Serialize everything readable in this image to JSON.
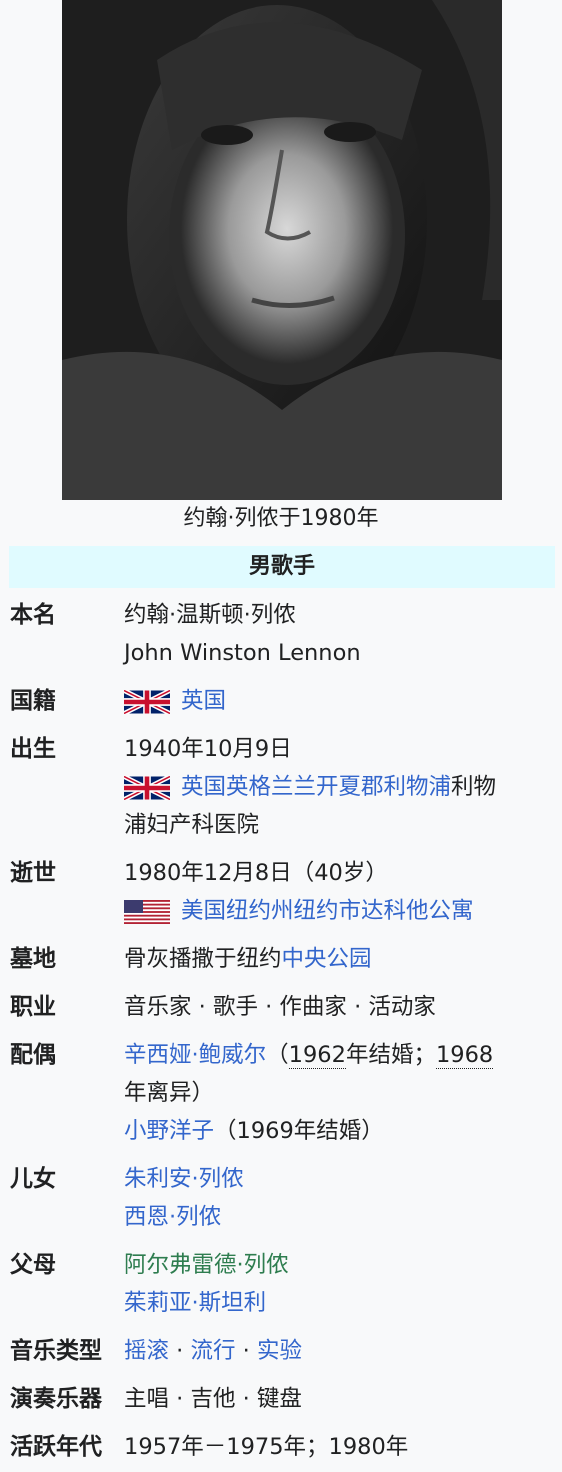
{
  "image": {
    "caption": "约翰·列侬于1980年"
  },
  "header": "男歌手",
  "rows": {
    "name": {
      "label": "本名",
      "zh": "约翰·温斯顿·列侬",
      "en": "John Winston Lennon"
    },
    "nationality": {
      "label": "国籍",
      "country": "英国"
    },
    "born": {
      "label": "出生",
      "date": "1940年10月9日",
      "place_link": "英国英格兰兰开夏郡利物浦",
      "place_tail_a": "利物",
      "place_tail_b": "浦妇产科医院"
    },
    "died": {
      "label": "逝世",
      "date": "1980年12月8日（40岁）",
      "place": "美国纽约州纽约市达科他公寓"
    },
    "grave": {
      "label": "墓地",
      "prefix": "骨灰播撒于纽约",
      "link": "中央公园"
    },
    "occupation": {
      "label": "职业",
      "text": "音乐家 · 歌手 · 作曲家 · 活动家"
    },
    "spouse": {
      "label": "配偶",
      "s1_name": "辛西娅·鲍威尔",
      "s1_p1": "（",
      "s1_y1": "1962",
      "s1_p2": "年结婚；",
      "s1_y2": "1968",
      "s1_p3": "年离异）",
      "s2_name": "小野洋子",
      "s2_note": "（1969年结婚）"
    },
    "children": {
      "label": "儿女",
      "c1": "朱利安·列侬",
      "c2": "西恩·列侬"
    },
    "parents": {
      "label": "父母",
      "p1": "阿尔弗雷德·列侬",
      "p2": "茱莉亚·斯坦利"
    },
    "genre": {
      "label": "音乐类型",
      "g1": "摇滚",
      "g2": "流行",
      "g3": "实验",
      "sep": " · "
    },
    "instrument": {
      "label": "演奏乐器",
      "text": "主唱 · 吉他 · 键盘"
    },
    "active": {
      "label": "活跃年代",
      "text": "1957年－1975年；1980年"
    }
  },
  "colors": {
    "link": "#3366cc",
    "visited": "#2e7d4f",
    "header_bg": "#e0fbff",
    "page_bg": "#f8f9fa"
  }
}
